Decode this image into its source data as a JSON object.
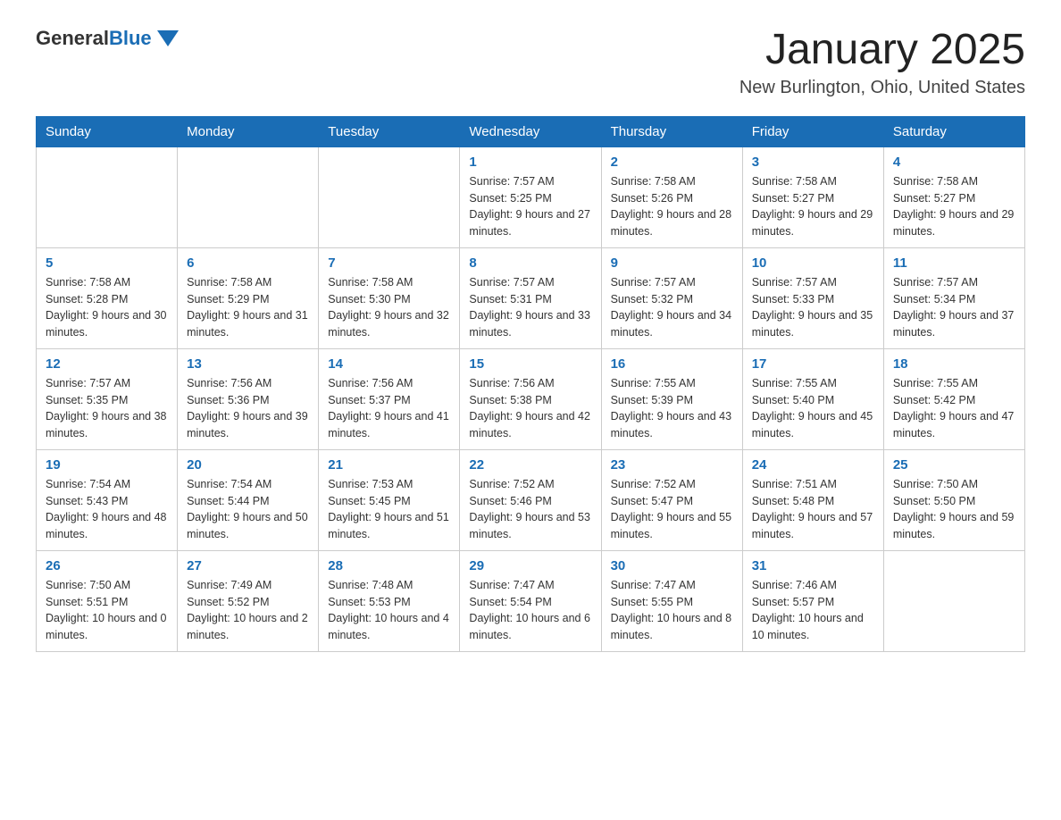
{
  "header": {
    "logo": {
      "general": "General",
      "blue": "Blue"
    },
    "title": "January 2025",
    "location": "New Burlington, Ohio, United States"
  },
  "calendar": {
    "days_of_week": [
      "Sunday",
      "Monday",
      "Tuesday",
      "Wednesday",
      "Thursday",
      "Friday",
      "Saturday"
    ],
    "weeks": [
      [
        {
          "day": "",
          "info": ""
        },
        {
          "day": "",
          "info": ""
        },
        {
          "day": "",
          "info": ""
        },
        {
          "day": "1",
          "info": "Sunrise: 7:57 AM\nSunset: 5:25 PM\nDaylight: 9 hours and 27 minutes."
        },
        {
          "day": "2",
          "info": "Sunrise: 7:58 AM\nSunset: 5:26 PM\nDaylight: 9 hours and 28 minutes."
        },
        {
          "day": "3",
          "info": "Sunrise: 7:58 AM\nSunset: 5:27 PM\nDaylight: 9 hours and 29 minutes."
        },
        {
          "day": "4",
          "info": "Sunrise: 7:58 AM\nSunset: 5:27 PM\nDaylight: 9 hours and 29 minutes."
        }
      ],
      [
        {
          "day": "5",
          "info": "Sunrise: 7:58 AM\nSunset: 5:28 PM\nDaylight: 9 hours and 30 minutes."
        },
        {
          "day": "6",
          "info": "Sunrise: 7:58 AM\nSunset: 5:29 PM\nDaylight: 9 hours and 31 minutes."
        },
        {
          "day": "7",
          "info": "Sunrise: 7:58 AM\nSunset: 5:30 PM\nDaylight: 9 hours and 32 minutes."
        },
        {
          "day": "8",
          "info": "Sunrise: 7:57 AM\nSunset: 5:31 PM\nDaylight: 9 hours and 33 minutes."
        },
        {
          "day": "9",
          "info": "Sunrise: 7:57 AM\nSunset: 5:32 PM\nDaylight: 9 hours and 34 minutes."
        },
        {
          "day": "10",
          "info": "Sunrise: 7:57 AM\nSunset: 5:33 PM\nDaylight: 9 hours and 35 minutes."
        },
        {
          "day": "11",
          "info": "Sunrise: 7:57 AM\nSunset: 5:34 PM\nDaylight: 9 hours and 37 minutes."
        }
      ],
      [
        {
          "day": "12",
          "info": "Sunrise: 7:57 AM\nSunset: 5:35 PM\nDaylight: 9 hours and 38 minutes."
        },
        {
          "day": "13",
          "info": "Sunrise: 7:56 AM\nSunset: 5:36 PM\nDaylight: 9 hours and 39 minutes."
        },
        {
          "day": "14",
          "info": "Sunrise: 7:56 AM\nSunset: 5:37 PM\nDaylight: 9 hours and 41 minutes."
        },
        {
          "day": "15",
          "info": "Sunrise: 7:56 AM\nSunset: 5:38 PM\nDaylight: 9 hours and 42 minutes."
        },
        {
          "day": "16",
          "info": "Sunrise: 7:55 AM\nSunset: 5:39 PM\nDaylight: 9 hours and 43 minutes."
        },
        {
          "day": "17",
          "info": "Sunrise: 7:55 AM\nSunset: 5:40 PM\nDaylight: 9 hours and 45 minutes."
        },
        {
          "day": "18",
          "info": "Sunrise: 7:55 AM\nSunset: 5:42 PM\nDaylight: 9 hours and 47 minutes."
        }
      ],
      [
        {
          "day": "19",
          "info": "Sunrise: 7:54 AM\nSunset: 5:43 PM\nDaylight: 9 hours and 48 minutes."
        },
        {
          "day": "20",
          "info": "Sunrise: 7:54 AM\nSunset: 5:44 PM\nDaylight: 9 hours and 50 minutes."
        },
        {
          "day": "21",
          "info": "Sunrise: 7:53 AM\nSunset: 5:45 PM\nDaylight: 9 hours and 51 minutes."
        },
        {
          "day": "22",
          "info": "Sunrise: 7:52 AM\nSunset: 5:46 PM\nDaylight: 9 hours and 53 minutes."
        },
        {
          "day": "23",
          "info": "Sunrise: 7:52 AM\nSunset: 5:47 PM\nDaylight: 9 hours and 55 minutes."
        },
        {
          "day": "24",
          "info": "Sunrise: 7:51 AM\nSunset: 5:48 PM\nDaylight: 9 hours and 57 minutes."
        },
        {
          "day": "25",
          "info": "Sunrise: 7:50 AM\nSunset: 5:50 PM\nDaylight: 9 hours and 59 minutes."
        }
      ],
      [
        {
          "day": "26",
          "info": "Sunrise: 7:50 AM\nSunset: 5:51 PM\nDaylight: 10 hours and 0 minutes."
        },
        {
          "day": "27",
          "info": "Sunrise: 7:49 AM\nSunset: 5:52 PM\nDaylight: 10 hours and 2 minutes."
        },
        {
          "day": "28",
          "info": "Sunrise: 7:48 AM\nSunset: 5:53 PM\nDaylight: 10 hours and 4 minutes."
        },
        {
          "day": "29",
          "info": "Sunrise: 7:47 AM\nSunset: 5:54 PM\nDaylight: 10 hours and 6 minutes."
        },
        {
          "day": "30",
          "info": "Sunrise: 7:47 AM\nSunset: 5:55 PM\nDaylight: 10 hours and 8 minutes."
        },
        {
          "day": "31",
          "info": "Sunrise: 7:46 AM\nSunset: 5:57 PM\nDaylight: 10 hours and 10 minutes."
        },
        {
          "day": "",
          "info": ""
        }
      ]
    ]
  }
}
